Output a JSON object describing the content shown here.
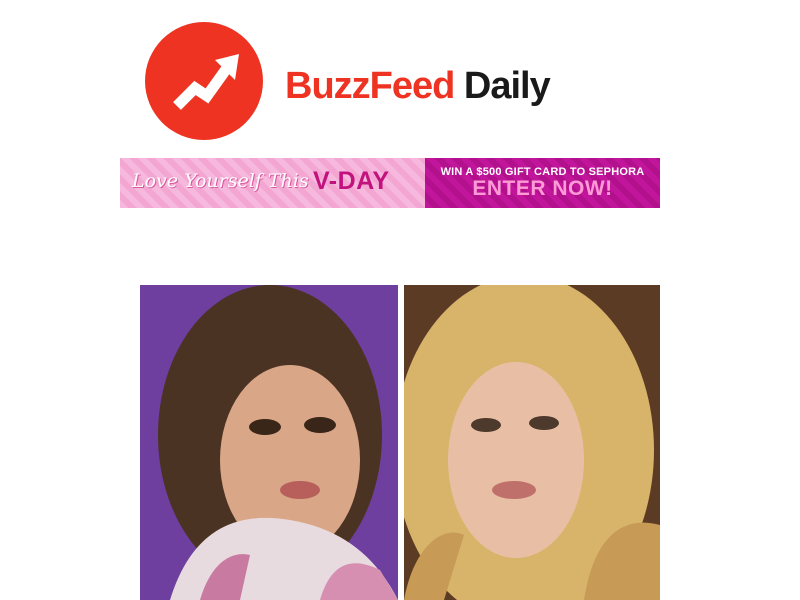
{
  "header": {
    "brand_part1": "BuzzFeed",
    "brand_part2": "Daily",
    "logo_icon": "trending-arrow-icon",
    "brand_color": "#ee3322"
  },
  "banner": {
    "left_script": "Love Yourself This",
    "left_highlight": "V-DAY",
    "right_line1": "WIN A $500 GIFT CARD TO SEPHORA",
    "right_cta": "ENTER NOW!",
    "colors": {
      "left_bg": "#f6b9dd",
      "right_bg": "#c1159b",
      "highlight": "#c2127e"
    }
  },
  "photos": [
    {
      "name": "left-photo",
      "bg": "#7a4aa6"
    },
    {
      "name": "right-photo",
      "bg": "#5a3a24"
    }
  ]
}
